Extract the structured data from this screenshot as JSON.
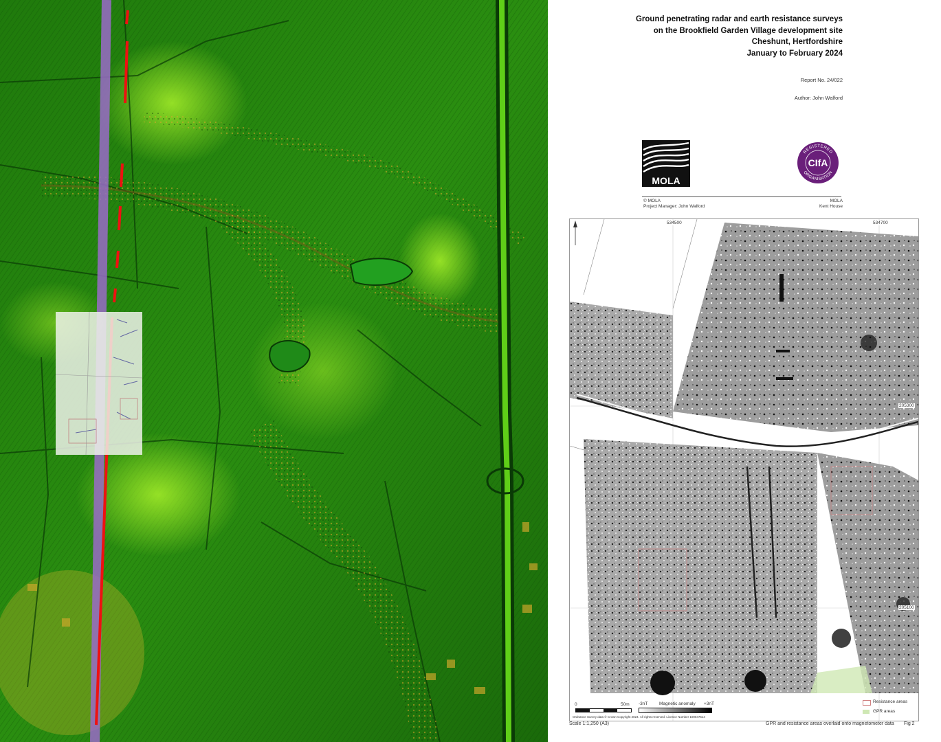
{
  "report": {
    "title_lines": [
      "Ground penetrating radar and earth resistance surveys",
      "on the Brookfield Garden Village development site",
      "Cheshunt, Hertfordshire",
      "January to February 2024"
    ],
    "report_no": "Report No. 24/022",
    "author": "Author: John Walford",
    "logo_mola": "MOLA",
    "logo_cifa_text": "CIfA",
    "logo_cifa_ring_top": "REGISTERED",
    "logo_cifa_ring_bottom": "ORGANISATION",
    "footer_left_1": "© MOLA",
    "footer_left_2": "Project Manager: John Walford",
    "footer_right_1": "MOLA",
    "footer_right_2": "Kent House"
  },
  "map": {
    "grid_x_labels": [
      "534500",
      "534700"
    ],
    "grid_y_labels": [
      "205300",
      "205100"
    ],
    "scale_zero": "0",
    "scale_end": "50m",
    "mag_min": "-3nT",
    "mag_label": "Magnetic anomaly",
    "mag_max": "+3nT",
    "legend_resistance": "Resistance areas",
    "legend_gpr": "GPR areas",
    "copyright": "Ordnance Survey data © Crown Copyright 2024. All rights reserved. Licence Number 100047514",
    "scale_label": "Scale 1:1,250 (A3)",
    "caption": "GPR and resistance areas overlaid onto magnetometer data",
    "fig": "Fig 2"
  },
  "colors": {
    "lidar_dark": "#0f5a0a",
    "lidar_mid": "#2f9a12",
    "lidar_bright": "#8fe81e",
    "route_red": "#ee1111",
    "route_purple": "#9a6bc8",
    "cifa_purple": "#6a1f7a"
  }
}
